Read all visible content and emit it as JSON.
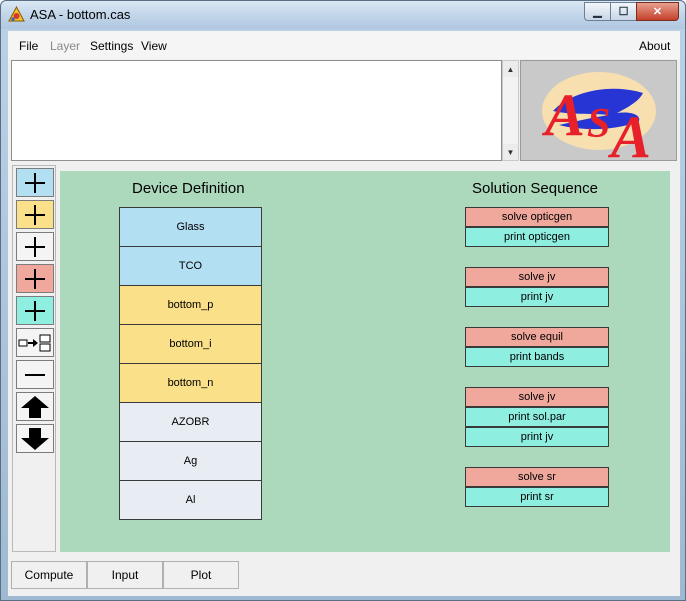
{
  "window": {
    "title": "ASA - bottom.cas",
    "minimize_glyph": "▁",
    "maximize_glyph": "☐",
    "close_glyph": "✕"
  },
  "menu": {
    "file": "File",
    "layer": "Layer",
    "settings": "Settings",
    "view": "View",
    "about": "About"
  },
  "textbox": {
    "value": ""
  },
  "logo": {
    "text": "ASA",
    "colors": {
      "letters": "#e8202a",
      "swoosh": "#1a2bd6",
      "oval": "#f7dfb0"
    }
  },
  "toolbar": {
    "buttons": [
      {
        "icon": "plus-icon",
        "color": "#b3dff3"
      },
      {
        "icon": "plus-icon",
        "color": "#fae089"
      },
      {
        "icon": "plus-icon",
        "color": "#f4f4f4"
      },
      {
        "icon": "plus-icon",
        "color": "#f0a79c"
      },
      {
        "icon": "plus-icon",
        "color": "#8eeee0"
      },
      {
        "icon": "insert-arrow-icon",
        "color": "#f4f4f4"
      },
      {
        "icon": "minus-icon",
        "color": "#f4f4f4"
      },
      {
        "icon": "arrow-up-icon",
        "color": "#f4f4f4"
      },
      {
        "icon": "arrow-down-icon",
        "color": "#f4f4f4"
      }
    ]
  },
  "device": {
    "title": "Device Definition",
    "layers": [
      {
        "name": "Glass",
        "color": "#b3dff3"
      },
      {
        "name": "TCO",
        "color": "#b3dff3"
      },
      {
        "name": "bottom_p",
        "color": "#fae089"
      },
      {
        "name": "bottom_i",
        "color": "#fae089"
      },
      {
        "name": "bottom_n",
        "color": "#fae089"
      },
      {
        "name": "AZOBR",
        "color": "#e7edf3"
      },
      {
        "name": "Ag",
        "color": "#e7edf3"
      },
      {
        "name": "Al",
        "color": "#e7edf3"
      }
    ]
  },
  "solution": {
    "title": "Solution Sequence",
    "steps": [
      {
        "label": "solve opticgen",
        "kind": "solve",
        "color": "#f0a79c"
      },
      {
        "label": "print opticgen",
        "kind": "print",
        "color": "#8eeee0"
      },
      {
        "label": "solve jv",
        "kind": "solve",
        "color": "#f0a79c"
      },
      {
        "label": "print jv",
        "kind": "print",
        "color": "#8eeee0"
      },
      {
        "label": "solve equil",
        "kind": "solve",
        "color": "#f0a79c"
      },
      {
        "label": "print bands",
        "kind": "print",
        "color": "#8eeee0"
      },
      {
        "label": "solve jv",
        "kind": "solve",
        "color": "#f0a79c"
      },
      {
        "label": "print sol.par",
        "kind": "print",
        "color": "#8eeee0"
      },
      {
        "label": "print jv",
        "kind": "print",
        "color": "#8eeee0"
      },
      {
        "label": "solve sr",
        "kind": "solve",
        "color": "#f0a79c"
      },
      {
        "label": "print sr",
        "kind": "print",
        "color": "#8eeee0"
      }
    ]
  },
  "bottom": {
    "compute": "Compute",
    "input": "Input",
    "plot": "Plot"
  },
  "colors": {
    "canvas": "#acd8bc"
  }
}
